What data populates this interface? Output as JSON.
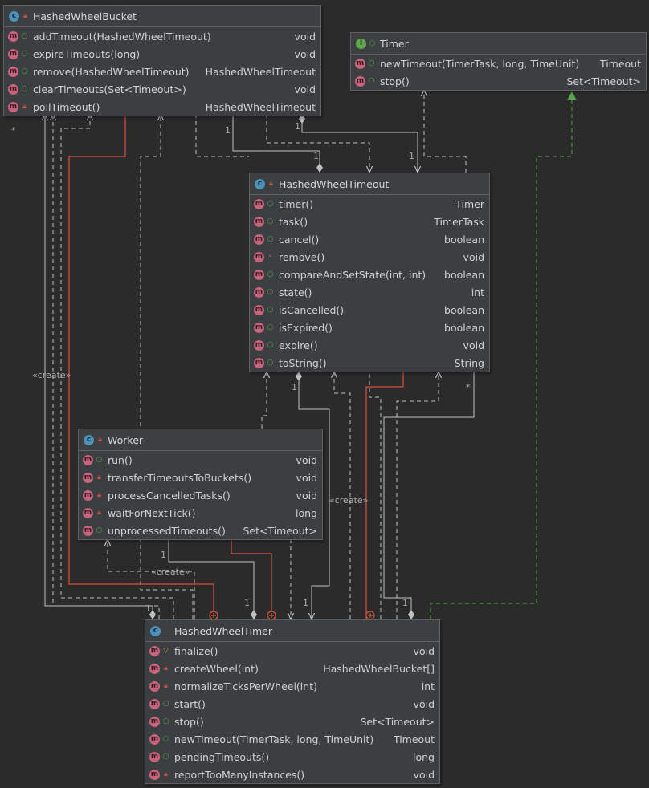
{
  "diagram": {
    "classes": {
      "bucket": {
        "name": "HashedWheelBucket",
        "kind": "class",
        "visibility": "private",
        "methods": [
          {
            "sig": "addTimeout(HashedWheelTimeout)",
            "ret": "void",
            "vis": "public"
          },
          {
            "sig": "expireTimeouts(long)",
            "ret": "void",
            "vis": "public"
          },
          {
            "sig": "remove(HashedWheelTimeout)",
            "ret": "HashedWheelTimeout",
            "vis": "public"
          },
          {
            "sig": "clearTimeouts(Set<Timeout>)",
            "ret": "void",
            "vis": "public"
          },
          {
            "sig": "pollTimeout()",
            "ret": "HashedWheelTimeout",
            "vis": "private"
          }
        ]
      },
      "timer": {
        "name": "Timer",
        "kind": "interface",
        "visibility": "public",
        "methods": [
          {
            "sig": "newTimeout(TimerTask, long, TimeUnit)",
            "ret": "Timeout",
            "vis": "public"
          },
          {
            "sig": "stop()",
            "ret": "Set<Timeout>",
            "vis": "public"
          }
        ]
      },
      "timeout": {
        "name": "HashedWheelTimeout",
        "kind": "class",
        "visibility": "private",
        "methods": [
          {
            "sig": "timer()",
            "ret": "Timer",
            "vis": "public"
          },
          {
            "sig": "task()",
            "ret": "TimerTask",
            "vis": "public"
          },
          {
            "sig": "cancel()",
            "ret": "boolean",
            "vis": "public"
          },
          {
            "sig": "remove()",
            "ret": "void",
            "vis": "package"
          },
          {
            "sig": "compareAndSetState(int, int)",
            "ret": "boolean",
            "vis": "public"
          },
          {
            "sig": "state()",
            "ret": "int",
            "vis": "public"
          },
          {
            "sig": "isCancelled()",
            "ret": "boolean",
            "vis": "public"
          },
          {
            "sig": "isExpired()",
            "ret": "boolean",
            "vis": "public"
          },
          {
            "sig": "expire()",
            "ret": "void",
            "vis": "public"
          },
          {
            "sig": "toString()",
            "ret": "String",
            "vis": "public"
          }
        ]
      },
      "worker": {
        "name": "Worker",
        "kind": "class",
        "visibility": "private",
        "methods": [
          {
            "sig": "run()",
            "ret": "void",
            "vis": "public"
          },
          {
            "sig": "transferTimeoutsToBuckets()",
            "ret": "void",
            "vis": "private"
          },
          {
            "sig": "processCancelledTasks()",
            "ret": "void",
            "vis": "private"
          },
          {
            "sig": "waitForNextTick()",
            "ret": "long",
            "vis": "private"
          },
          {
            "sig": "unprocessedTimeouts()",
            "ret": "Set<Timeout>",
            "vis": "public"
          }
        ]
      },
      "wheel": {
        "name": "HashedWheelTimer",
        "kind": "class",
        "visibility": "public",
        "methods": [
          {
            "sig": "finalize()",
            "ret": "void",
            "vis": "protected"
          },
          {
            "sig": "createWheel(int)",
            "ret": "HashedWheelBucket[]",
            "vis": "private"
          },
          {
            "sig": "normalizeTicksPerWheel(int)",
            "ret": "int",
            "vis": "private"
          },
          {
            "sig": "start()",
            "ret": "void",
            "vis": "public"
          },
          {
            "sig": "stop()",
            "ret": "Set<Timeout>",
            "vis": "public"
          },
          {
            "sig": "newTimeout(TimerTask, long, TimeUnit)",
            "ret": "Timeout",
            "vis": "public"
          },
          {
            "sig": "pendingTimeouts()",
            "ret": "long",
            "vis": "public"
          },
          {
            "sig": "reportTooManyInstances()",
            "ret": "void",
            "vis": "private"
          }
        ]
      }
    },
    "edge_labels": {
      "create_left": "«create»",
      "create_mid": "«create»",
      "create_bottom": "«create»",
      "one": "1",
      "many": "*"
    },
    "colors": {
      "background": "#2b2b2b",
      "dependency": "#bfc1c3",
      "inner_class": "#d9513f",
      "implements": "#55a64a"
    },
    "icons": {
      "method": "m",
      "class": "c",
      "interface": "I"
    }
  }
}
